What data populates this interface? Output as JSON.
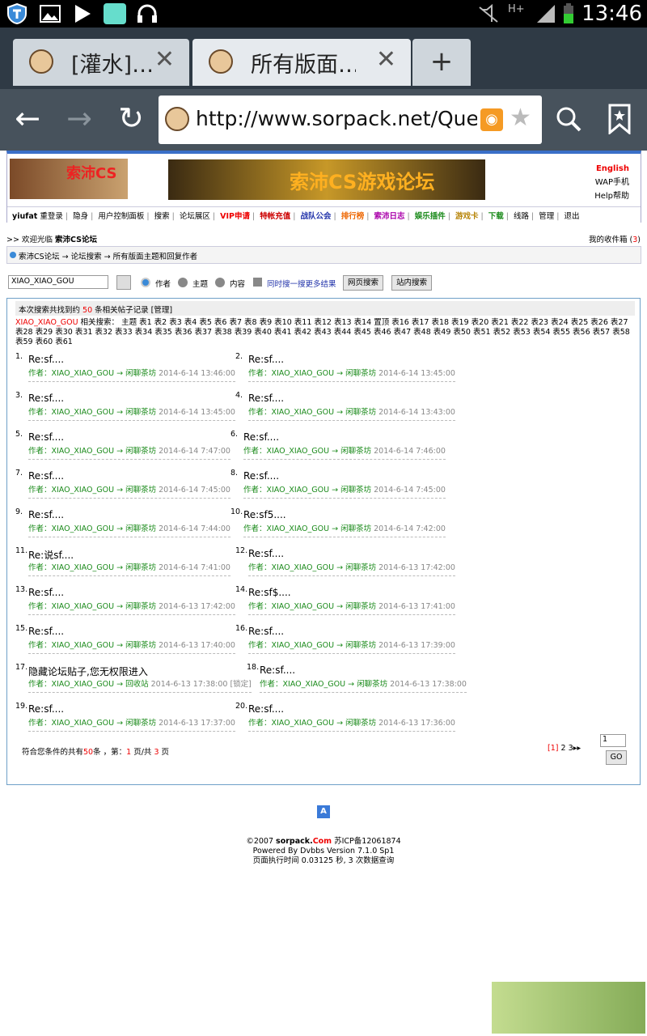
{
  "status": {
    "time": "13:46",
    "network": "H+"
  },
  "tabs": [
    {
      "title": "[灌水]…"
    },
    {
      "title": "所有版面…"
    }
  ],
  "newtab_label": "+",
  "url": "http://www.sorpack.net/Query.a",
  "header": {
    "logo_text": "索沛CS",
    "banner_text": "索沛CS游戏论坛",
    "english": "English",
    "wap": "WAP手机",
    "help": "Help帮助"
  },
  "menu": [
    "yiufat",
    "重登录",
    "隐身",
    "用户控制面板",
    "搜索",
    "论坛展区",
    "VIP申请",
    "特帐充值",
    "战队公会",
    "排行榜",
    "索沛日志",
    "娱乐插件",
    "游戏卡",
    "下载",
    "线路",
    "管理",
    "退出"
  ],
  "welcome": {
    "prefix": ">> 欢迎光临 ",
    "site": "索沛CS论坛"
  },
  "inbox": {
    "label": "我的收件箱 (",
    "count": "3",
    "suffix": ")"
  },
  "breadcrumb": "索沛CS论坛 → 论坛搜索 → 所有版面主题和回复作者",
  "search": {
    "value": "XIAO_XIAO_GOU",
    "opt_author": "作者",
    "opt_topic": "主题",
    "opt_content": "内容",
    "more": "同时搜一搜更多结果",
    "btn_web": "网页搜索",
    "btn_site": "站内搜索"
  },
  "results_header": {
    "prefix": "本次搜索共找到约 ",
    "count": "50",
    "suffix": " 条相关帖子记录 [管理]"
  },
  "tags_line1_user": "XIAO_XIAO_GOU",
  "tags_line1": " 相关搜索： 主题 表1 表2 表3 表4 表5 表6 表7 表8 表9 表10 表11 表12 表13 表14 置顶 表16 表17 表18 表19 表20 表21 表22 表23 表24 表25 表26 表27 表28 表29 表30 表31 表32 表33 表34 表35 表36 表37 表38 表39 表40 表41 表42 表43 表44 表45 表46 表47 表48 表49 表50 表51 表52 表53 表54 表55 表56 表57 表58 表59 表60 表61",
  "items": [
    {
      "num": "1.",
      "title": "Re:sf....",
      "author": "作者：XIAO_XIAO_GOU",
      "arrow": "→",
      "board": "闲聊茶坊",
      "date": "2014-6-14 13:46:00"
    },
    {
      "num": "2.",
      "title": "Re:sf....",
      "author": "作者：XIAO_XIAO_GOU",
      "arrow": "→",
      "board": "闲聊茶坊",
      "date": "2014-6-14 13:45:00"
    },
    {
      "num": "3.",
      "title": "Re:sf....",
      "author": "作者：XIAO_XIAO_GOU",
      "arrow": "→",
      "board": "闲聊茶坊",
      "date": "2014-6-14 13:45:00"
    },
    {
      "num": "4.",
      "title": "Re:sf....",
      "author": "作者：XIAO_XIAO_GOU",
      "arrow": "→",
      "board": "闲聊茶坊",
      "date": "2014-6-14 13:43:00"
    },
    {
      "num": "5.",
      "title": "Re:sf....",
      "author": "作者：XIAO_XIAO_GOU",
      "arrow": "→",
      "board": "闲聊茶坊",
      "date": "2014-6-14 7:47:00"
    },
    {
      "num": "6.",
      "title": "Re:sf....",
      "author": "作者：XIAO_XIAO_GOU",
      "arrow": "→",
      "board": "闲聊茶坊",
      "date": "2014-6-14 7:46:00"
    },
    {
      "num": "7.",
      "title": "Re:sf....",
      "author": "作者：XIAO_XIAO_GOU",
      "arrow": "→",
      "board": "闲聊茶坊",
      "date": "2014-6-14 7:45:00"
    },
    {
      "num": "8.",
      "title": "Re:sf....",
      "author": "作者：XIAO_XIAO_GOU",
      "arrow": "→",
      "board": "闲聊茶坊",
      "date": "2014-6-14 7:45:00"
    },
    {
      "num": "9.",
      "title": "Re:sf....",
      "author": "作者：XIAO_XIAO_GOU",
      "arrow": "→",
      "board": "闲聊茶坊",
      "date": "2014-6-14 7:44:00"
    },
    {
      "num": "10.",
      "title": "Re:sf5....",
      "author": "作者：XIAO_XIAO_GOU",
      "arrow": "→",
      "board": "闲聊茶坊",
      "date": "2014-6-14 7:42:00"
    },
    {
      "num": "11.",
      "title": "Re:说sf....",
      "author": "作者：XIAO_XIAO_GOU",
      "arrow": "→",
      "board": "闲聊茶坊",
      "date": "2014-6-14 7:41:00"
    },
    {
      "num": "12.",
      "title": "Re:sf....",
      "author": "作者：XIAO_XIAO_GOU",
      "arrow": "→",
      "board": "闲聊茶坊",
      "date": "2014-6-13 17:42:00"
    },
    {
      "num": "13.",
      "title": "Re:sf....",
      "author": "作者：XIAO_XIAO_GOU",
      "arrow": "→",
      "board": "闲聊茶坊",
      "date": "2014-6-13 17:42:00"
    },
    {
      "num": "14.",
      "title": "Re:sf$....",
      "author": "作者：XIAO_XIAO_GOU",
      "arrow": "→",
      "board": "闲聊茶坊",
      "date": "2014-6-13 17:41:00"
    },
    {
      "num": "15.",
      "title": "Re:sf....",
      "author": "作者：XIAO_XIAO_GOU",
      "arrow": "→",
      "board": "闲聊茶坊",
      "date": "2014-6-13 17:40:00"
    },
    {
      "num": "16.",
      "title": "Re:sf....",
      "author": "作者：XIAO_XIAO_GOU",
      "arrow": "→",
      "board": "闲聊茶坊",
      "date": "2014-6-13 17:39:00"
    },
    {
      "num": "17.",
      "title": "隐藏论坛贴子,您无权限进入",
      "author": "作者：XIAO_XIAO_GOU",
      "arrow": "→",
      "board": "回收站",
      "date": "2014-6-13 17:38:00 [锁定]"
    },
    {
      "num": "18.",
      "title": "Re:sf....",
      "author": "作者：XIAO_XIAO_GOU",
      "arrow": "→",
      "board": "闲聊茶坊",
      "date": "2014-6-13 17:38:00"
    },
    {
      "num": "19.",
      "title": "Re:sf....",
      "author": "作者：XIAO_XIAO_GOU",
      "arrow": "→",
      "board": "闲聊茶坊",
      "date": "2014-6-13 17:37:00"
    },
    {
      "num": "20.",
      "title": "Re:sf....",
      "author": "作者：XIAO_XIAO_GOU",
      "arrow": "→",
      "board": "闲聊茶坊",
      "date": "2014-6-13 17:36:00"
    }
  ],
  "summary": {
    "p1": "符合您条件的共有",
    "total": "50",
    "p2": "条 ，第：",
    "page": "1",
    "p3": " 页/共 ",
    "pages": "3",
    "p4": " 页"
  },
  "pager": {
    "current": "[1]",
    "others": "2 3",
    "next": "▸▸"
  },
  "goto": {
    "value": "1",
    "btn": "GO"
  },
  "footer": {
    "copy_prefix": "©2007 ",
    "copy_brand": "sorpack.",
    "copy_com": "Com",
    "icp": " 苏ICP备12061874",
    "powered": "Powered By Dvbbs Version 7.1.0 Sp1",
    "exec": "页面执行时间 0.03125 秒, 3 次数据查询"
  },
  "watermark": "索沛CS",
  "aicon": "A"
}
